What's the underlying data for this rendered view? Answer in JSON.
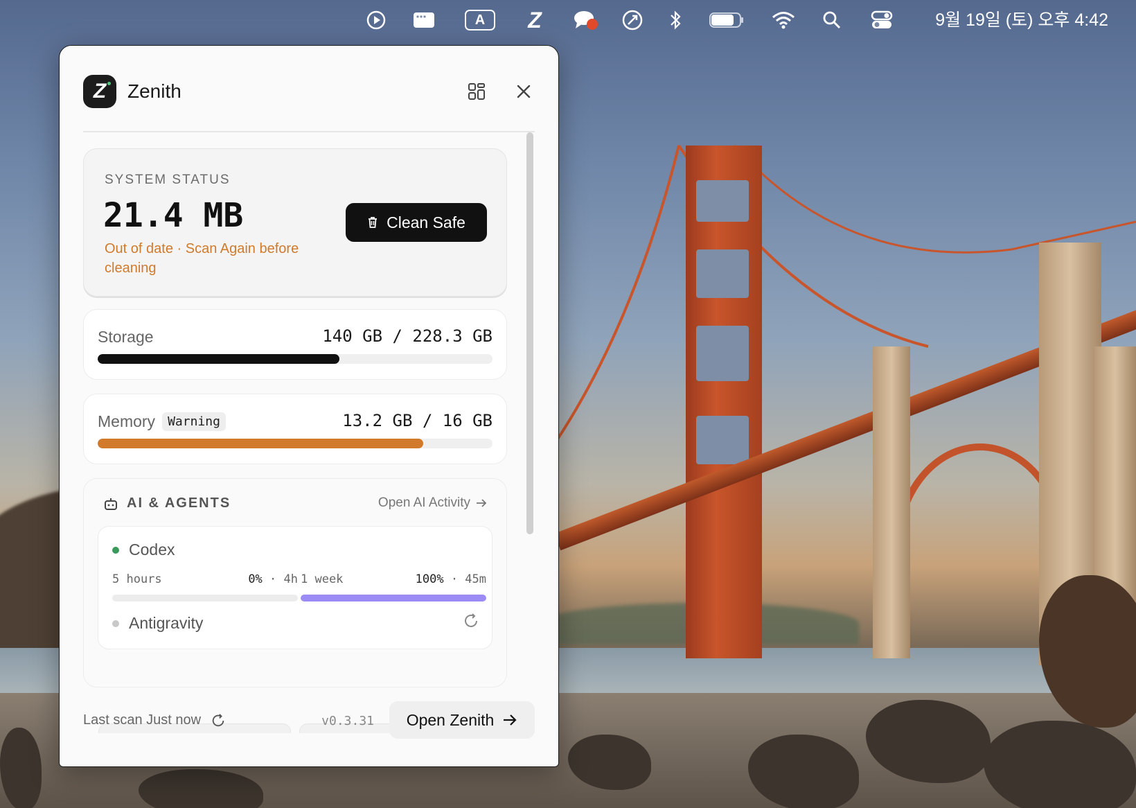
{
  "menubar": {
    "icons": [
      "play-icon",
      "window-icon",
      "input-source-icon",
      "zenith-menu-icon",
      "chat-icon",
      "rocket-icon",
      "bluetooth-icon",
      "battery-icon",
      "wifi-icon",
      "search-icon",
      "control-center-icon"
    ],
    "input_letter": "A",
    "zenith_letter": "Z",
    "clock": "9월 19일 (토) 오후 4:42"
  },
  "app": {
    "title": "Zenith",
    "logo_letter": "Z"
  },
  "system_status": {
    "label": "SYSTEM STATUS",
    "value": "21.4 MB",
    "note": "Out of date · Scan Again before cleaning",
    "clean_button": "Clean Safe"
  },
  "storage": {
    "label": "Storage",
    "value": "140 GB / 228.3 GB",
    "used_fraction": 0.613,
    "color": "#111111"
  },
  "memory": {
    "label": "Memory",
    "badge": "Warning",
    "value": "13.2 GB / 16 GB",
    "used_fraction": 0.825,
    "color": "#d27a2c"
  },
  "ai": {
    "heading": "AI & AGENTS",
    "link": "Open AI Activity",
    "agents": [
      {
        "name": "Codex",
        "status_color": "#3a9a5b",
        "quotas": [
          {
            "label": "5 hours",
            "percent": "0%",
            "reset": "· 4h",
            "fraction": 0,
            "color": "#7c6cf0"
          },
          {
            "label": "1 week",
            "percent": "100%",
            "reset": "· 45m",
            "fraction": 1,
            "color": "#9b8cf5"
          }
        ]
      },
      {
        "name": "Antigravity",
        "status_color": "#c8c8c8"
      }
    ]
  },
  "footer": {
    "last_scan": "Last scan Just now",
    "version": "v0.3.31",
    "open_button": "Open Zenith"
  }
}
